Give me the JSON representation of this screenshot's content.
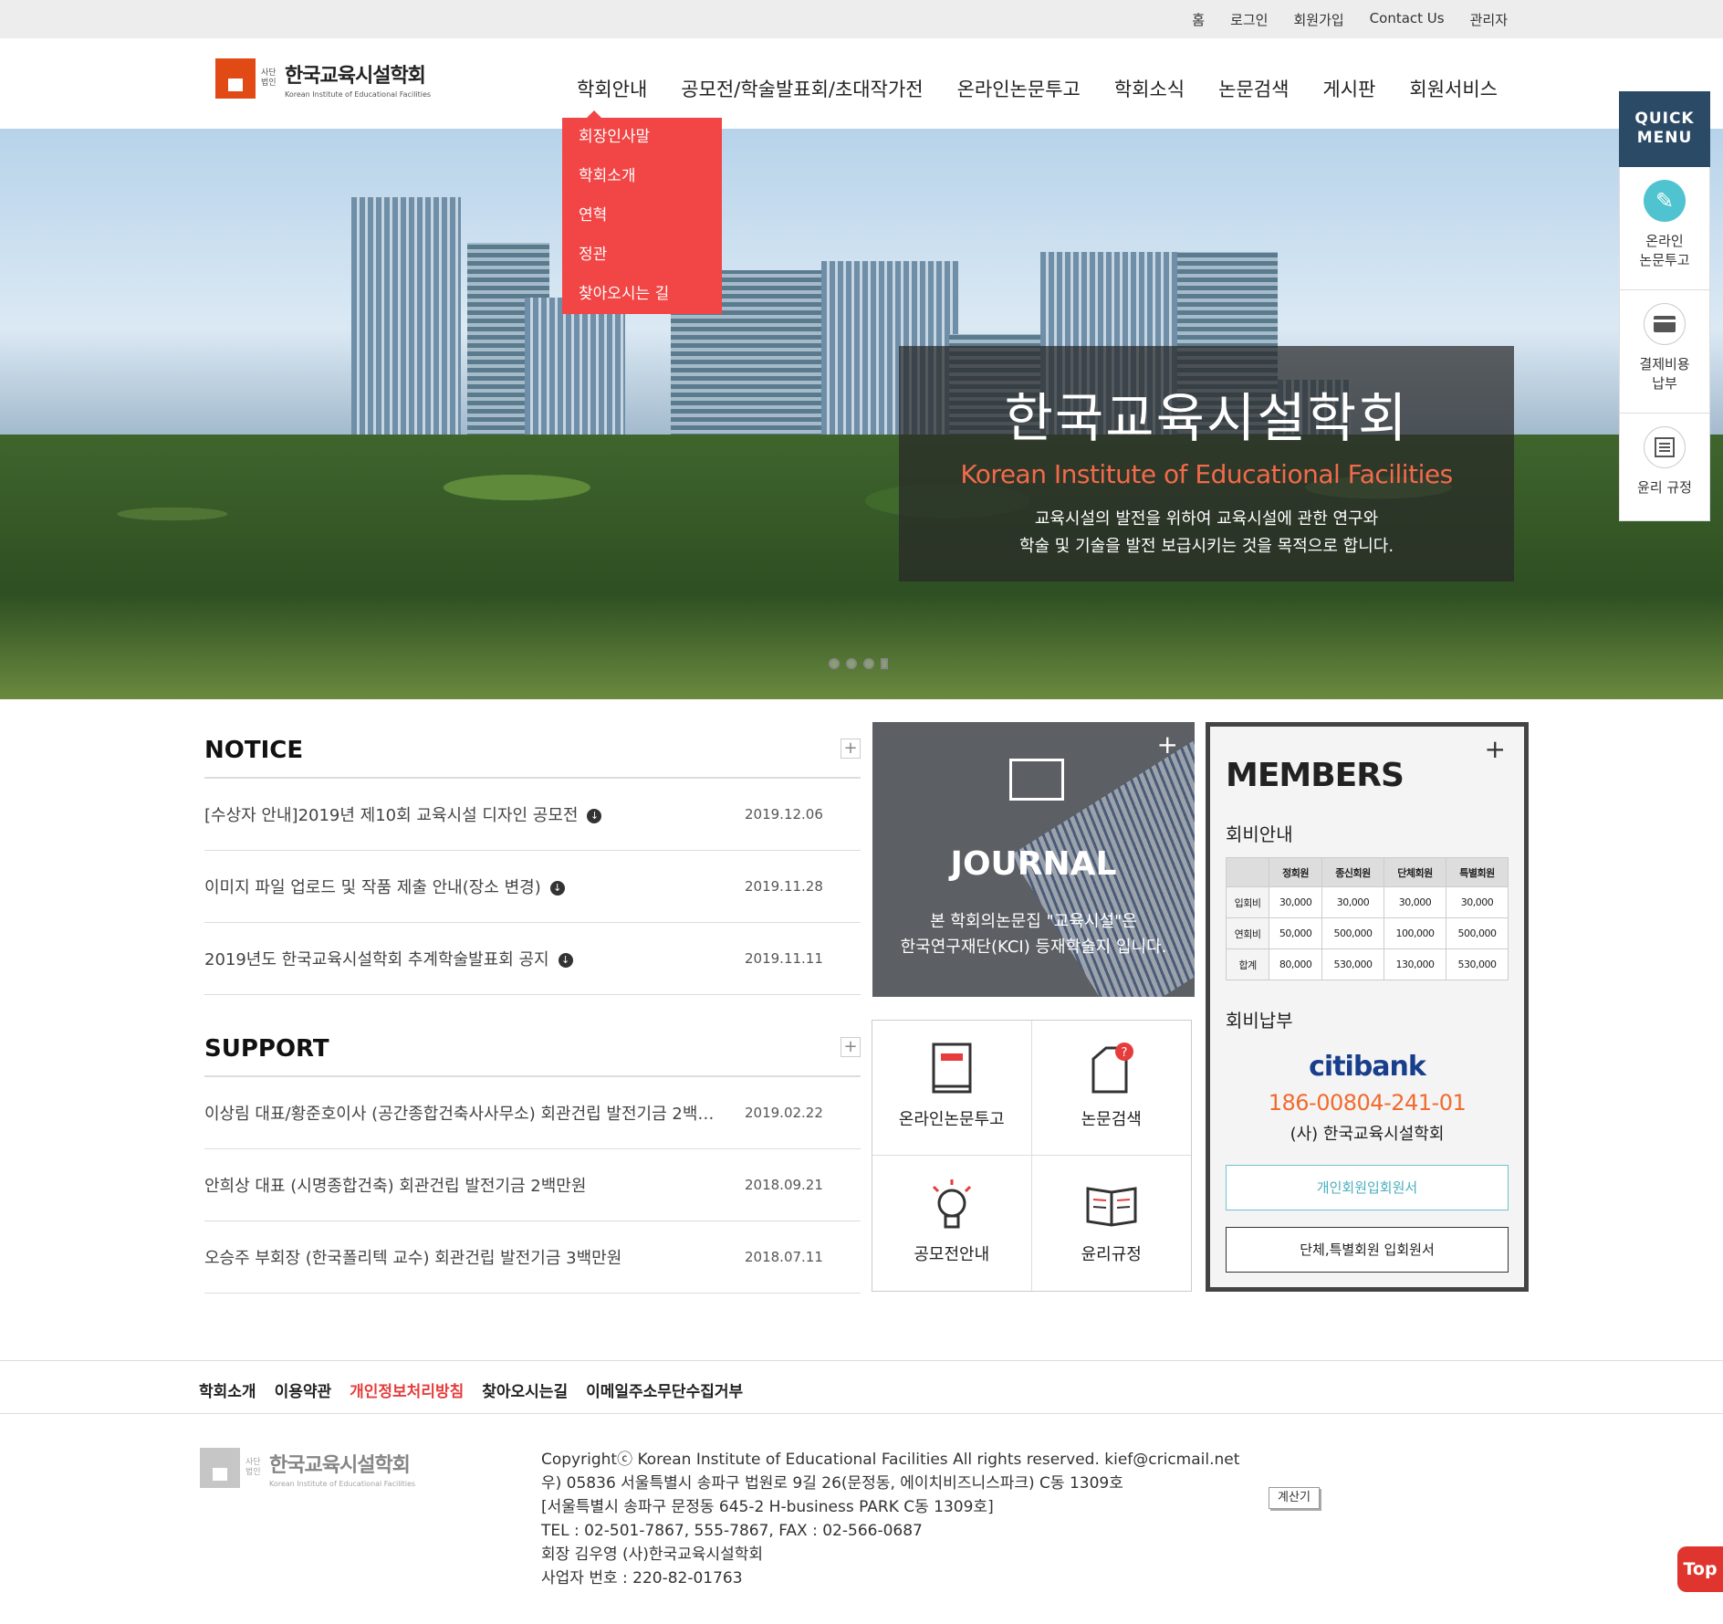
{
  "topbar": {
    "links": [
      "홈",
      "로그인",
      "회원가입",
      "Contact Us",
      "관리자"
    ]
  },
  "logo": {
    "small": "사단 법인",
    "title": "한국교육시설학회",
    "subtitle": "Korean Institute of Educational Facilities",
    "accent": "#e14a14"
  },
  "nav": {
    "items": [
      "학회안내",
      "공모전/학술발표회/초대작가전",
      "온라인논문투고",
      "학회소식",
      "논문검색",
      "게시판",
      "회원서비스"
    ]
  },
  "dropdown": {
    "items": [
      "회장인사말",
      "학회소개",
      "연혁",
      "정관",
      "찾아오시는 길"
    ],
    "color": "#f24545"
  },
  "hero": {
    "title": "한국교육시설학회",
    "subtitle": "Korean Institute of Educational Facilities",
    "desc1": "교육시설의 발전을 위하여 교육시설에 관한 연구와",
    "desc2": "학술 및 기술을 발전 보급시키는 것을 목적으로 합니다."
  },
  "quick": {
    "title1": "QUICK",
    "title2": "MENU",
    "items": [
      {
        "label1": "온라인",
        "label2": "논문투고",
        "icon": "pencil-icon"
      },
      {
        "label1": "결제비용",
        "label2": "납부",
        "icon": "card-icon"
      },
      {
        "label1": "윤리 규정",
        "label2": "",
        "icon": "list-icon"
      }
    ]
  },
  "notice": {
    "title": "NOTICE",
    "rows": [
      {
        "title": "[수상자 안내]2019년 제10회 교육시설 디자인 공모전",
        "date": "2019.12.06"
      },
      {
        "title": "이미지 파일 업로드 및 작품 제출 안내(장소 변경)",
        "date": "2019.11.28"
      },
      {
        "title": "2019년도 한국교육시설학회 추계학술발표회 공지",
        "date": "2019.11.11"
      }
    ]
  },
  "support": {
    "title": "SUPPORT",
    "rows": [
      {
        "title": "이상림 대표/황준호이사 (공간종합건축사사무소) 회관건립 발전기금 2백…",
        "date": "2019.02.22"
      },
      {
        "title": "안희상 대표 (시명종합건축) 회관건립 발전기금 2백만원",
        "date": "2018.09.21"
      },
      {
        "title": "오승주 부회장 (한국폴리텍 교수) 회관건립 발전기금 3백만원",
        "date": "2018.07.11"
      }
    ]
  },
  "journal": {
    "title": "JOURNAL",
    "desc1": "본 학회의논문집 \"교육시설\"은",
    "desc2": "한국연구재단(KCI) 등재학술지 입니다."
  },
  "grid": {
    "items": [
      "온라인논문투고",
      "논문검색",
      "공모전안내",
      "윤리규정"
    ]
  },
  "members": {
    "title": "MEMBERS",
    "info_title": "회비안내",
    "headers": [
      "",
      "정회원",
      "종신회원",
      "단체회원",
      "특별회원"
    ],
    "rows": [
      [
        "입회비",
        "30,000",
        "30,000",
        "30,000",
        "30,000"
      ],
      [
        "연회비",
        "50,000",
        "500,000",
        "100,000",
        "500,000"
      ],
      [
        "합계",
        "80,000",
        "530,000",
        "130,000",
        "530,000"
      ]
    ],
    "pay_title": "회비납부",
    "bank": "citibank",
    "account": "186-00804-241-01",
    "account_name": "(사) 한국교육시설학회",
    "btn1": "개인회원입회원서",
    "btn2": "단체,특별회원 입회원서"
  },
  "footer": {
    "links": [
      "학회소개",
      "이용약관",
      "개인정보처리방침",
      "찾아오시는길",
      "이메일주소무단수집거부"
    ],
    "lines": [
      "Copyrightⓒ  Korean Institute of Educational Facilities All rights reserved. kief@cricmail.net",
      "우) 05836 서울특별시 송파구 법원로 9길 26(문정동, 에이치비즈니스파크) C동 1309호",
      "[서울특별시 송파구 문정동 645-2 H-business PARK C동 1309호]",
      "TEL : 02-501-7867, 555-7867, FAX : 02-566-0687",
      "회장 김우영 (사)한국교육시설학회",
      "사업자 번호 : 220-82-01763"
    ],
    "calc": "계산기",
    "top": "Top"
  }
}
